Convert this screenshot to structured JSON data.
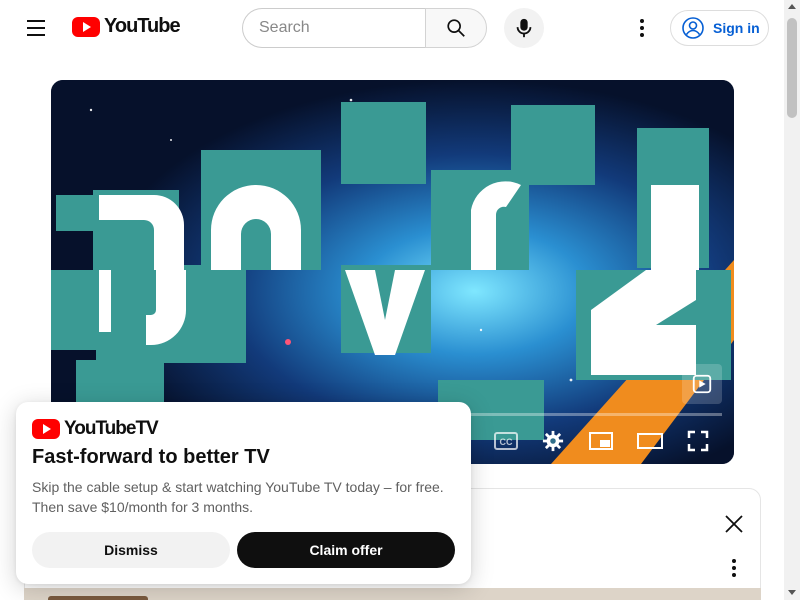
{
  "header": {
    "logo_text": "YouTube",
    "search_placeholder": "Search",
    "signin_label": "Sign in"
  },
  "player": {
    "controls": [
      "closed-captions",
      "settings",
      "miniplayer",
      "theater-mode",
      "fullscreen"
    ]
  },
  "promo": {
    "logo_text": "YouTubeTV",
    "title": "Fast-forward to better TV",
    "body": "Skip the cable setup & start watching YouTube TV today – for free. Then save $10/month for 3 months.",
    "dismiss_label": "Dismiss",
    "claim_label": "Claim offer"
  },
  "colors": {
    "brand_red": "#ff0000",
    "link_blue": "#065fd4",
    "teal_tiles": "#3a9a94"
  },
  "icons": [
    "menu-icon",
    "youtube-logo-icon",
    "search-icon",
    "mic-icon",
    "more-vert-icon",
    "account-circle-icon",
    "cc-icon",
    "gear-icon",
    "miniplayer-icon",
    "theater-icon",
    "fullscreen-icon",
    "close-icon"
  ]
}
